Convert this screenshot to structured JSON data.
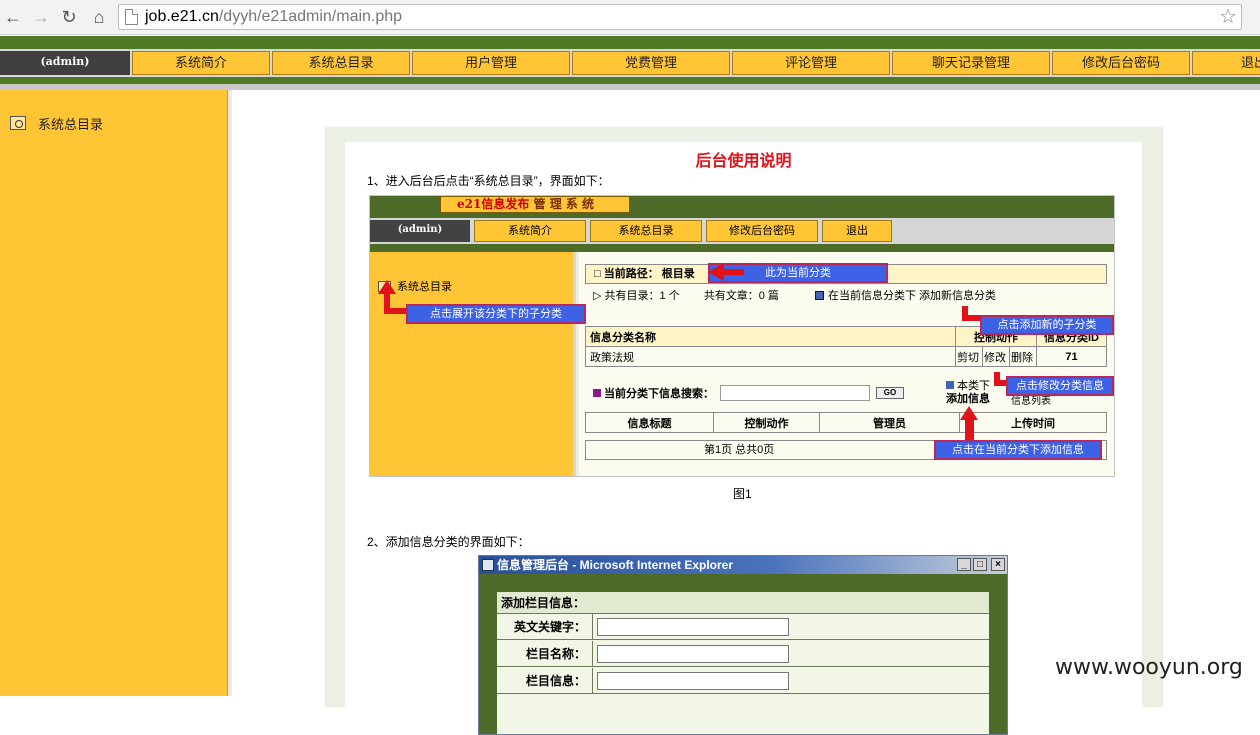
{
  "browser": {
    "back_icon": "back-arrow-icon",
    "url_host": "job.e21.cn",
    "url_path": "/dyyh/e21admin/main.php"
  },
  "nav": {
    "admin_label": "(admin)",
    "items": [
      {
        "label": "系统简介"
      },
      {
        "label": "系统总目录"
      },
      {
        "label": "用户管理"
      },
      {
        "label": "党费管理"
      },
      {
        "label": "评论管理"
      },
      {
        "label": "聊天记录管理"
      },
      {
        "label": "修改后台密码"
      },
      {
        "label": "退出"
      }
    ]
  },
  "sidebar": {
    "items": [
      {
        "label": "系统总目录"
      }
    ]
  },
  "doc": {
    "title": "后台使用说明",
    "step1": "1、进入后台后点击“系统总目录”，界面如下：",
    "caption1": "图1",
    "step2": "2、添加信息分类的界面如下："
  },
  "fig1": {
    "logo_red": "e21信息发布",
    "logo_black": " 管 理 系 统",
    "admin_label": "(admin)",
    "nav_items": [
      {
        "label": "系统简介"
      },
      {
        "label": "系统总目录"
      },
      {
        "label": "修改后台密码"
      },
      {
        "label": "退出"
      }
    ],
    "tree_item": "系统总目录",
    "path_label": "□ 当前路径：  根目录",
    "count_dirs": "共有目录：1 个",
    "count_articles": "共有文章：0 篇",
    "add_category": "在当前信息分类下 添加新信息分类",
    "table_headers": [
      "信息分类名称",
      "控制动作",
      "信息分类ID"
    ],
    "row_name": "政策法规",
    "row_actions": [
      "剪切",
      "修改",
      "删除"
    ],
    "row_id": "71",
    "search_label": "当前分类下信息搜索：",
    "search_button": "GO",
    "local_1": "本类下",
    "local_2": "添加信息",
    "list_label": "信息列表",
    "list_headers": [
      "信息标题",
      "控制动作",
      "管理员",
      "上传时间"
    ],
    "pager": "第1页     总共0页",
    "callouts": {
      "current_category": "此为当前分类",
      "expand_subcategory": "点击展开该分类下的子分类",
      "add_subcategory": "点击添加新的子分类",
      "edit_category": "点击修改分类信息",
      "add_info": "点击在当前分类下添加信息"
    }
  },
  "fig2": {
    "window_title": "信息管理后台 - Microsoft Internet Explorer",
    "window_buttons": [
      "_",
      "□",
      "×"
    ],
    "form_caption": "添加栏目信息：",
    "fields": [
      {
        "label": "英文关键字："
      },
      {
        "label": "栏目名称："
      },
      {
        "label": "栏目信息："
      }
    ]
  },
  "watermark": "www.wooyun.org"
}
